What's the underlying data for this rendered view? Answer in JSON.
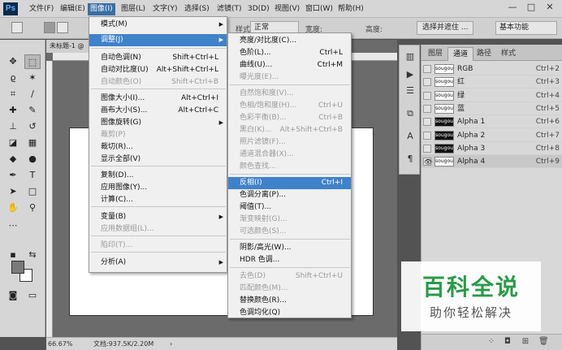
{
  "app": {
    "logo": "Ps"
  },
  "menubar": {
    "items": [
      "文件(F)",
      "编辑(E)",
      "图像(I)",
      "图层(L)",
      "文字(Y)",
      "选择(S)",
      "滤镜(T)",
      "3D(D)",
      "视图(V)",
      "窗口(W)",
      "帮助(H)"
    ],
    "window_controls": [
      "—",
      "□",
      "✕"
    ]
  },
  "options_bar": {
    "style_label": "样式:",
    "style_value": "正常",
    "width_label": "宽度:",
    "height_label": "高度:",
    "select_mask_button": "选择并遮住 ...",
    "workspace_value": "基本功能"
  },
  "document": {
    "tab_title": "未标题-1 @",
    "zoom": "66.67%",
    "doc_info": "文档:937.5K/2.20M"
  },
  "image_menu": {
    "items": [
      {
        "label": "模式(M)",
        "shortcut": "",
        "submenu": true,
        "disabled": false
      },
      {
        "label": "调整(J)",
        "shortcut": "",
        "submenu": true,
        "disabled": false,
        "highlighted": true
      },
      {
        "label": "自动色调(N)",
        "shortcut": "Shift+Ctrl+L",
        "disabled": false
      },
      {
        "label": "自动对比度(U)",
        "shortcut": "Alt+Shift+Ctrl+L",
        "disabled": false
      },
      {
        "label": "自动颜色(O)",
        "shortcut": "Shift+Ctrl+B",
        "disabled": true
      },
      {
        "label": "图像大小(I)...",
        "shortcut": "Alt+Ctrl+I",
        "disabled": false
      },
      {
        "label": "画布大小(S)...",
        "shortcut": "Alt+Ctrl+C",
        "disabled": false
      },
      {
        "label": "图像旋转(G)",
        "shortcut": "",
        "submenu": true,
        "disabled": false
      },
      {
        "label": "裁剪(P)",
        "shortcut": "",
        "disabled": true
      },
      {
        "label": "裁切(R)...",
        "shortcut": "",
        "disabled": false
      },
      {
        "label": "显示全部(V)",
        "shortcut": "",
        "disabled": false
      },
      {
        "label": "复制(D)...",
        "shortcut": "",
        "disabled": false
      },
      {
        "label": "应用图像(Y)...",
        "shortcut": "",
        "disabled": false
      },
      {
        "label": "计算(C)...",
        "shortcut": "",
        "disabled": false
      },
      {
        "label": "变量(B)",
        "shortcut": "",
        "submenu": true,
        "disabled": false
      },
      {
        "label": "应用数据组(L)...",
        "shortcut": "",
        "disabled": true
      },
      {
        "label": "陷印(T)...",
        "shortcut": "",
        "disabled": true
      },
      {
        "label": "分析(A)",
        "shortcut": "",
        "submenu": true,
        "disabled": false
      }
    ]
  },
  "adjust_menu": {
    "items": [
      {
        "label": "亮度/对比度(C)...",
        "shortcut": "",
        "disabled": false
      },
      {
        "label": "色阶(L)...",
        "shortcut": "Ctrl+L",
        "disabled": false
      },
      {
        "label": "曲线(U)...",
        "shortcut": "Ctrl+M",
        "disabled": false
      },
      {
        "label": "曝光度(E)...",
        "shortcut": "",
        "disabled": true
      },
      {
        "label": "自然饱和度(V)...",
        "shortcut": "",
        "disabled": true
      },
      {
        "label": "色相/饱和度(H)...",
        "shortcut": "Ctrl+U",
        "disabled": true
      },
      {
        "label": "色彩平衡(B)...",
        "shortcut": "Ctrl+B",
        "disabled": true
      },
      {
        "label": "黑白(K)...",
        "shortcut": "Alt+Shift+Ctrl+B",
        "disabled": true
      },
      {
        "label": "照片滤镜(F)...",
        "shortcut": "",
        "disabled": true
      },
      {
        "label": "通道混合器(X)...",
        "shortcut": "",
        "disabled": true
      },
      {
        "label": "颜色查找...",
        "shortcut": "",
        "disabled": true
      },
      {
        "label": "反相(I)",
        "shortcut": "Ctrl+I",
        "disabled": false,
        "highlighted": true
      },
      {
        "label": "色调分离(P)...",
        "shortcut": "",
        "disabled": false
      },
      {
        "label": "阈值(T)...",
        "shortcut": "",
        "disabled": false
      },
      {
        "label": "渐变映射(G)...",
        "shortcut": "",
        "disabled": true
      },
      {
        "label": "可选颜色(S)...",
        "shortcut": "",
        "disabled": true
      },
      {
        "label": "阴影/高光(W)...",
        "shortcut": "",
        "disabled": false
      },
      {
        "label": "HDR 色调...",
        "shortcut": "",
        "disabled": false
      },
      {
        "label": "去色(D)",
        "shortcut": "Shift+Ctrl+U",
        "disabled": true
      },
      {
        "label": "匹配颜色(M)...",
        "shortcut": "",
        "disabled": true
      },
      {
        "label": "替换颜色(R)...",
        "shortcut": "",
        "disabled": false
      },
      {
        "label": "色调均化(Q)",
        "shortcut": "",
        "disabled": false
      }
    ]
  },
  "channels_panel": {
    "tabs": [
      "图层",
      "通道",
      "路径",
      "样式"
    ],
    "active_tab": 1,
    "rows": [
      {
        "name": "RGB",
        "shortcut": "Ctrl+2",
        "thumb": "sougou",
        "dark": false,
        "visible": false,
        "selected": false
      },
      {
        "name": "红",
        "shortcut": "Ctrl+3",
        "thumb": "sougou",
        "dark": false,
        "visible": false,
        "selected": false
      },
      {
        "name": "绿",
        "shortcut": "Ctrl+4",
        "thumb": "sougou",
        "dark": false,
        "visible": false,
        "selected": false
      },
      {
        "name": "蓝",
        "shortcut": "Ctrl+5",
        "thumb": "sougou",
        "dark": false,
        "visible": false,
        "selected": false
      },
      {
        "name": "Alpha 1",
        "shortcut": "Ctrl+6",
        "thumb": "sougou",
        "dark": true,
        "visible": false,
        "selected": false
      },
      {
        "name": "Alpha 2",
        "shortcut": "Ctrl+7",
        "thumb": "sougou",
        "dark": true,
        "visible": false,
        "selected": false
      },
      {
        "name": "Alpha 3",
        "shortcut": "Ctrl+8",
        "thumb": "sougou",
        "dark": true,
        "visible": false,
        "selected": false
      },
      {
        "name": "Alpha 4",
        "shortcut": "Ctrl+9",
        "thumb": "sougou",
        "dark": false,
        "visible": true,
        "selected": true
      }
    ]
  },
  "watermark": {
    "title": "百科全说",
    "subtitle": "助你轻松解决"
  },
  "colors": {
    "accent": "#3f82c9",
    "watermark_green": "#2b9a4a"
  }
}
